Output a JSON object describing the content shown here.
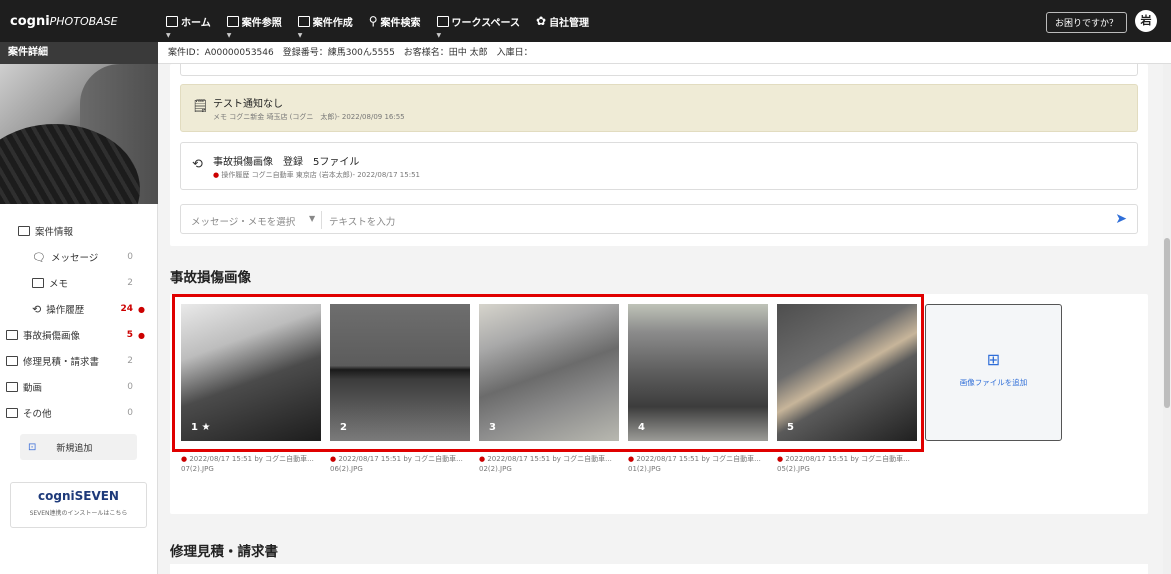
{
  "app": {
    "logo_main": "cogni",
    "logo_sub": "PHOTOBASE",
    "help_label": "お困りですか？",
    "user_initial": "岩"
  },
  "nav": {
    "items": [
      {
        "label": "ホーム",
        "icon": "home-icon"
      },
      {
        "label": "案件参照",
        "icon": "case-view-icon"
      },
      {
        "label": "案件作成",
        "icon": "case-create-icon"
      },
      {
        "label": "案件検索",
        "icon": "search-icon"
      },
      {
        "label": "ワークスペース",
        "icon": "workspace-icon"
      },
      {
        "label": "自社管理",
        "icon": "gear-icon"
      }
    ]
  },
  "subbar": {
    "title": "案件詳細",
    "info": "案件ID：A00000053546　登録番号：練馬300ん5555　お客様名：田中 太郎　入庫日："
  },
  "sidebar": {
    "case_info": "案件情報",
    "items": [
      {
        "label": "メッセージ",
        "count": "0",
        "icon": "message-icon"
      },
      {
        "label": "メモ",
        "count": "2",
        "icon": "memo-icon"
      },
      {
        "label": "操作履歴",
        "count": "24",
        "icon": "history-icon"
      }
    ],
    "folders": [
      {
        "label": "事故損傷画像",
        "count": "5"
      },
      {
        "label": "修理見積・請求書",
        "count": "2"
      },
      {
        "label": "動画",
        "count": "0"
      },
      {
        "label": "その他",
        "count": "0"
      }
    ],
    "add_label": "新規追加",
    "seven_brand": "cogniSEVEN",
    "seven_note": "SEVEN連携のインストールはこちら"
  },
  "timeline": {
    "note_title": "テスト通知なし",
    "note_meta": "メモ コグニ新金 埼玉店 (コグニ　太郎)- 2022/08/09 16:55",
    "hist_title": "事故損傷画像　登録　5ファイル",
    "hist_meta": "操作履歴 コグニ自動車 東京店 (岩本太郎)- 2022/08/17 15:51",
    "msg_select": "メッセージ・メモを選択",
    "msg_placeholder": "テキストを入力"
  },
  "photos_section": {
    "title": "事故損傷画像",
    "add_label": "画像ファイルを追加",
    "photos": [
      {
        "num": "1 ★",
        "caption": "2022/08/17 15:51 by コグニ自動車...",
        "file": "07(2).JPG"
      },
      {
        "num": "2",
        "caption": "2022/08/17 15:51 by コグニ自動車...",
        "file": "06(2).JPG"
      },
      {
        "num": "3",
        "caption": "2022/08/17 15:51 by コグニ自動車...",
        "file": "02(2).JPG"
      },
      {
        "num": "4",
        "caption": "2022/08/17 15:51 by コグニ自動車...",
        "file": "01(2).JPG"
      },
      {
        "num": "5",
        "caption": "2022/08/17 15:51 by コグニ自動車...",
        "file": "05(2).JPG"
      }
    ]
  },
  "repair_section": {
    "title": "修理見積・請求書"
  },
  "colors": {
    "accent": "#2f6ed8",
    "highlight": "#e00000",
    "topbar": "#1e1e1e"
  }
}
